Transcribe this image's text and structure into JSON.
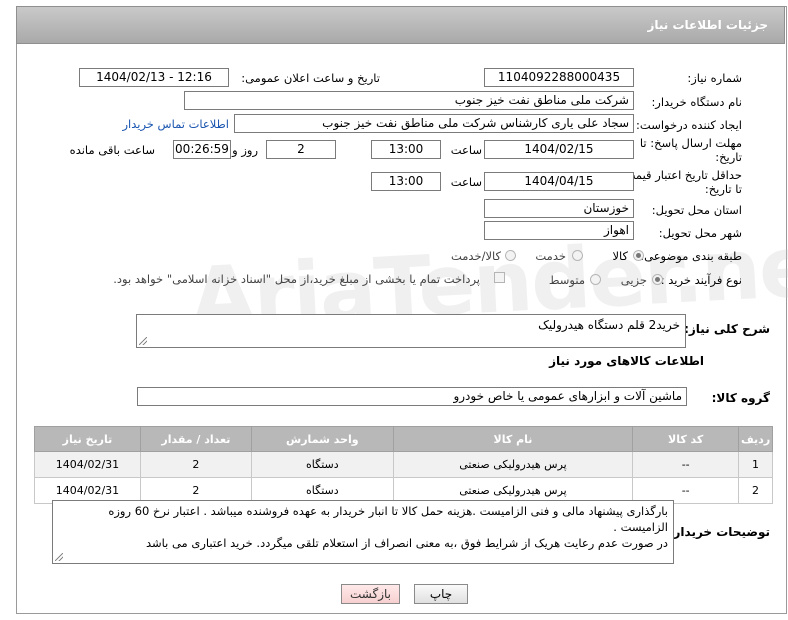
{
  "header": {
    "title": "جزئیات اطلاعات نیاز"
  },
  "fields": {
    "need_number_label": "شماره نیاز:",
    "need_number": "1104092288000435",
    "announce_label": "تاریخ و ساعت اعلان عمومی:",
    "announce_value": "1404/02/13 - 12:16",
    "buyer_org_label": "نام دستگاه خریدار:",
    "buyer_org": "شرکت ملی مناطق نفت خیز جنوب",
    "requester_label": "ایجاد کننده درخواست:",
    "requester": "سجاد علی یاری کارشناس شرکت ملی مناطق نفت خیز جنوب",
    "contact_link": "اطلاعات تماس خریدار",
    "deadline_label_1": "مهلت ارسال پاسخ: تا",
    "deadline_label_2": "تاریخ:",
    "deadline_date": "1404/02/15",
    "time_label": "ساعت",
    "deadline_time": "13:00",
    "days_value": "2",
    "days_label": "روز و",
    "remaining_time": "00:26:59",
    "remaining_label": "ساعت باقی مانده",
    "price_label_1": "حداقل تاریخ اعتبار قیمت:",
    "price_label_2": "تا تاریخ:",
    "price_date": "1404/04/15",
    "price_time": "13:00",
    "province_label": "استان محل تحویل:",
    "province": "خوزستان",
    "city_label": "شهر محل تحویل:",
    "city": "اهواز",
    "category_label": "طبقه بندی موضوعی:",
    "category_options": [
      "کالا",
      "خدمت",
      "کالا/خدمت"
    ],
    "category_selected": "کالا",
    "process_label": "نوع فرآیند خرید :",
    "process_options": [
      "جزیی",
      "متوسط"
    ],
    "process_selected": "جزیی",
    "payment_note": "پرداخت تمام یا بخشی از مبلغ خرید،از محل \"اسناد خزانه اسلامی\" خواهد بود."
  },
  "description": {
    "label": "شرح کلی نیاز:",
    "value": "خرید2 قلم دستگاه هیدرولیک"
  },
  "goods": {
    "section_title": "اطلاعات کالاهای مورد نیاز",
    "group_label": "گروه کالا:",
    "group_value": "ماشین آلات و ابزارهای عمومی یا خاص خودرو",
    "columns": [
      "ردیف",
      "کد کالا",
      "نام کالا",
      "واحد شمارش",
      "تعداد / مقدار",
      "تاریخ نیاز"
    ],
    "rows": [
      [
        "1",
        "--",
        "پرس هیدرولیکی صنعتی",
        "دستگاه",
        "2",
        "1404/02/31"
      ],
      [
        "2",
        "--",
        "پرس هیدرولیکی صنعتی",
        "دستگاه",
        "2",
        "1404/02/31"
      ]
    ]
  },
  "buyer_notes": {
    "label": "توضیحات خریدار:",
    "lines": [
      "بارگذاری پیشنهاد مالی و فنی الزامیست .هزینه حمل کالا تا انبار خریدار به عهده فروشنده میباشد . اعتبار نرخ 60 روزه",
      "الزامیست .",
      "در صورت عدم رعایت هریک از شرایط فوق ،به معنی انصراف از استعلام تلقی میگردد. خرید اعتباری می باشد"
    ]
  },
  "buttons": {
    "print": "چاپ",
    "back": "بازگشت"
  }
}
